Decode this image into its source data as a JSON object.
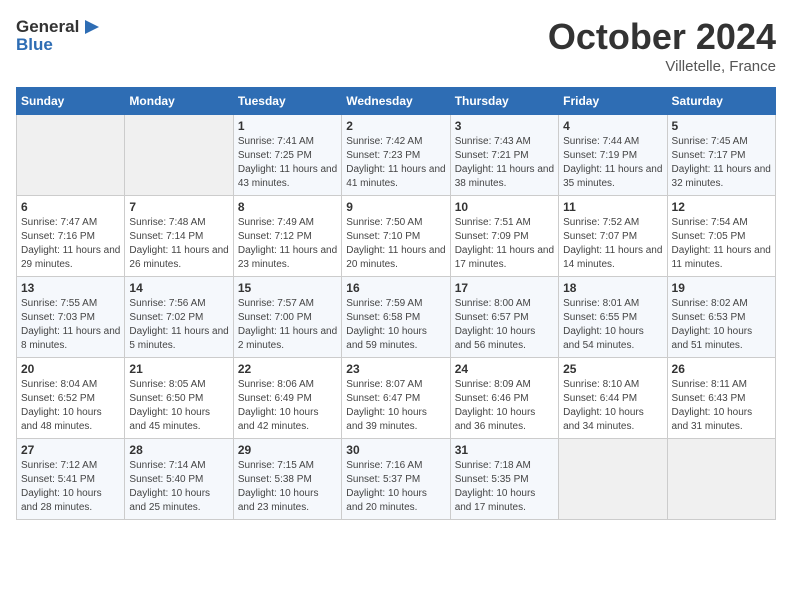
{
  "header": {
    "logo_line1": "General",
    "logo_line2": "Blue",
    "month_title": "October 2024",
    "location": "Villetelle, France"
  },
  "weekdays": [
    "Sunday",
    "Monday",
    "Tuesday",
    "Wednesday",
    "Thursday",
    "Friday",
    "Saturday"
  ],
  "weeks": [
    [
      {
        "day": "",
        "empty": true
      },
      {
        "day": "",
        "empty": true
      },
      {
        "day": "1",
        "sunrise": "Sunrise: 7:41 AM",
        "sunset": "Sunset: 7:25 PM",
        "daylight": "Daylight: 11 hours and 43 minutes."
      },
      {
        "day": "2",
        "sunrise": "Sunrise: 7:42 AM",
        "sunset": "Sunset: 7:23 PM",
        "daylight": "Daylight: 11 hours and 41 minutes."
      },
      {
        "day": "3",
        "sunrise": "Sunrise: 7:43 AM",
        "sunset": "Sunset: 7:21 PM",
        "daylight": "Daylight: 11 hours and 38 minutes."
      },
      {
        "day": "4",
        "sunrise": "Sunrise: 7:44 AM",
        "sunset": "Sunset: 7:19 PM",
        "daylight": "Daylight: 11 hours and 35 minutes."
      },
      {
        "day": "5",
        "sunrise": "Sunrise: 7:45 AM",
        "sunset": "Sunset: 7:17 PM",
        "daylight": "Daylight: 11 hours and 32 minutes."
      }
    ],
    [
      {
        "day": "6",
        "sunrise": "Sunrise: 7:47 AM",
        "sunset": "Sunset: 7:16 PM",
        "daylight": "Daylight: 11 hours and 29 minutes."
      },
      {
        "day": "7",
        "sunrise": "Sunrise: 7:48 AM",
        "sunset": "Sunset: 7:14 PM",
        "daylight": "Daylight: 11 hours and 26 minutes."
      },
      {
        "day": "8",
        "sunrise": "Sunrise: 7:49 AM",
        "sunset": "Sunset: 7:12 PM",
        "daylight": "Daylight: 11 hours and 23 minutes."
      },
      {
        "day": "9",
        "sunrise": "Sunrise: 7:50 AM",
        "sunset": "Sunset: 7:10 PM",
        "daylight": "Daylight: 11 hours and 20 minutes."
      },
      {
        "day": "10",
        "sunrise": "Sunrise: 7:51 AM",
        "sunset": "Sunset: 7:09 PM",
        "daylight": "Daylight: 11 hours and 17 minutes."
      },
      {
        "day": "11",
        "sunrise": "Sunrise: 7:52 AM",
        "sunset": "Sunset: 7:07 PM",
        "daylight": "Daylight: 11 hours and 14 minutes."
      },
      {
        "day": "12",
        "sunrise": "Sunrise: 7:54 AM",
        "sunset": "Sunset: 7:05 PM",
        "daylight": "Daylight: 11 hours and 11 minutes."
      }
    ],
    [
      {
        "day": "13",
        "sunrise": "Sunrise: 7:55 AM",
        "sunset": "Sunset: 7:03 PM",
        "daylight": "Daylight: 11 hours and 8 minutes."
      },
      {
        "day": "14",
        "sunrise": "Sunrise: 7:56 AM",
        "sunset": "Sunset: 7:02 PM",
        "daylight": "Daylight: 11 hours and 5 minutes."
      },
      {
        "day": "15",
        "sunrise": "Sunrise: 7:57 AM",
        "sunset": "Sunset: 7:00 PM",
        "daylight": "Daylight: 11 hours and 2 minutes."
      },
      {
        "day": "16",
        "sunrise": "Sunrise: 7:59 AM",
        "sunset": "Sunset: 6:58 PM",
        "daylight": "Daylight: 10 hours and 59 minutes."
      },
      {
        "day": "17",
        "sunrise": "Sunrise: 8:00 AM",
        "sunset": "Sunset: 6:57 PM",
        "daylight": "Daylight: 10 hours and 56 minutes."
      },
      {
        "day": "18",
        "sunrise": "Sunrise: 8:01 AM",
        "sunset": "Sunset: 6:55 PM",
        "daylight": "Daylight: 10 hours and 54 minutes."
      },
      {
        "day": "19",
        "sunrise": "Sunrise: 8:02 AM",
        "sunset": "Sunset: 6:53 PM",
        "daylight": "Daylight: 10 hours and 51 minutes."
      }
    ],
    [
      {
        "day": "20",
        "sunrise": "Sunrise: 8:04 AM",
        "sunset": "Sunset: 6:52 PM",
        "daylight": "Daylight: 10 hours and 48 minutes."
      },
      {
        "day": "21",
        "sunrise": "Sunrise: 8:05 AM",
        "sunset": "Sunset: 6:50 PM",
        "daylight": "Daylight: 10 hours and 45 minutes."
      },
      {
        "day": "22",
        "sunrise": "Sunrise: 8:06 AM",
        "sunset": "Sunset: 6:49 PM",
        "daylight": "Daylight: 10 hours and 42 minutes."
      },
      {
        "day": "23",
        "sunrise": "Sunrise: 8:07 AM",
        "sunset": "Sunset: 6:47 PM",
        "daylight": "Daylight: 10 hours and 39 minutes."
      },
      {
        "day": "24",
        "sunrise": "Sunrise: 8:09 AM",
        "sunset": "Sunset: 6:46 PM",
        "daylight": "Daylight: 10 hours and 36 minutes."
      },
      {
        "day": "25",
        "sunrise": "Sunrise: 8:10 AM",
        "sunset": "Sunset: 6:44 PM",
        "daylight": "Daylight: 10 hours and 34 minutes."
      },
      {
        "day": "26",
        "sunrise": "Sunrise: 8:11 AM",
        "sunset": "Sunset: 6:43 PM",
        "daylight": "Daylight: 10 hours and 31 minutes."
      }
    ],
    [
      {
        "day": "27",
        "sunrise": "Sunrise: 7:12 AM",
        "sunset": "Sunset: 5:41 PM",
        "daylight": "Daylight: 10 hours and 28 minutes."
      },
      {
        "day": "28",
        "sunrise": "Sunrise: 7:14 AM",
        "sunset": "Sunset: 5:40 PM",
        "daylight": "Daylight: 10 hours and 25 minutes."
      },
      {
        "day": "29",
        "sunrise": "Sunrise: 7:15 AM",
        "sunset": "Sunset: 5:38 PM",
        "daylight": "Daylight: 10 hours and 23 minutes."
      },
      {
        "day": "30",
        "sunrise": "Sunrise: 7:16 AM",
        "sunset": "Sunset: 5:37 PM",
        "daylight": "Daylight: 10 hours and 20 minutes."
      },
      {
        "day": "31",
        "sunrise": "Sunrise: 7:18 AM",
        "sunset": "Sunset: 5:35 PM",
        "daylight": "Daylight: 10 hours and 17 minutes."
      },
      {
        "day": "",
        "empty": true
      },
      {
        "day": "",
        "empty": true
      }
    ]
  ]
}
